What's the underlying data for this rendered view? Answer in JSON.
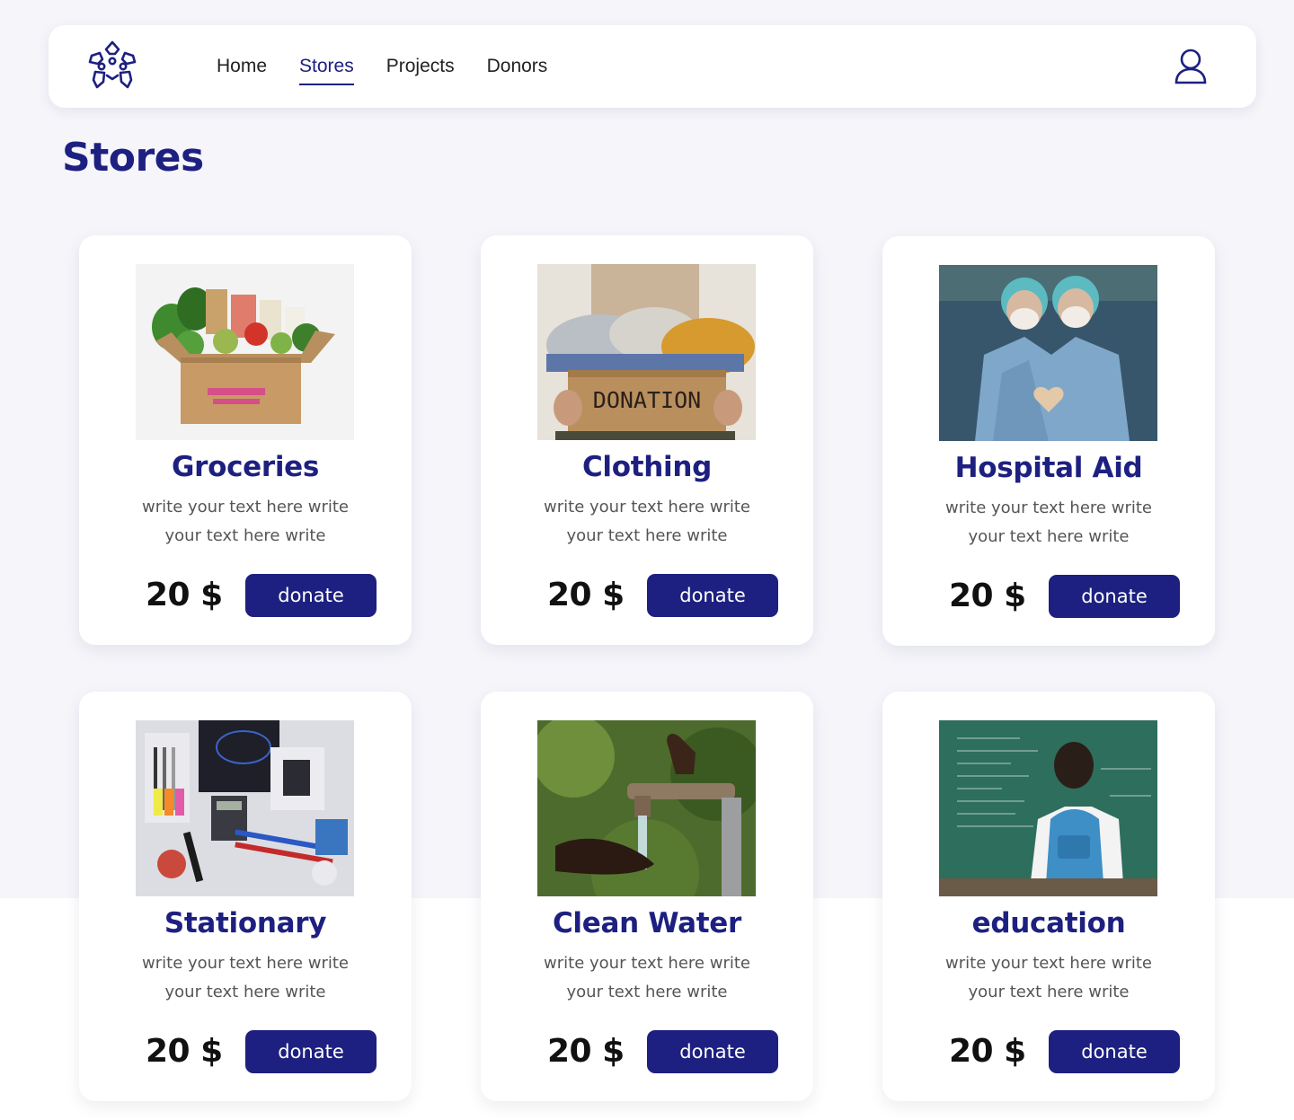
{
  "nav": {
    "logo_icon": "hands-logo-icon",
    "links": [
      {
        "label": "Home",
        "active": false
      },
      {
        "label": "Stores",
        "active": true
      },
      {
        "label": "Projects",
        "active": false
      },
      {
        "label": "Donors",
        "active": false
      }
    ],
    "user_icon": "user-icon"
  },
  "page": {
    "title": "Stores"
  },
  "colors": {
    "brand": "#1d2080",
    "background": "#f5f5fa"
  },
  "stores": [
    {
      "title": "Groceries",
      "description": "write your text here write your text here write",
      "price": "20 $",
      "button": "donate",
      "image": "groceries-box-image"
    },
    {
      "title": "Clothing",
      "description": "write your text here write your text here write",
      "price": "20 $",
      "button": "donate",
      "image": "donation-clothes-box-image"
    },
    {
      "title": "Hospital Aid",
      "description": "write your text here write your text here write",
      "price": "20 $",
      "button": "donate",
      "image": "medical-staff-image"
    },
    {
      "title": "Stationary",
      "description": "write your text here write your text here write",
      "price": "20 $",
      "button": "donate",
      "image": "school-supplies-image"
    },
    {
      "title": "Clean Water",
      "description": "write your text here write your text here write",
      "price": "20 $",
      "button": "donate",
      "image": "water-tap-image"
    },
    {
      "title": "education",
      "description": "write your text here write your text here write",
      "price": "20 $",
      "button": "donate",
      "image": "student-blackboard-image"
    }
  ]
}
